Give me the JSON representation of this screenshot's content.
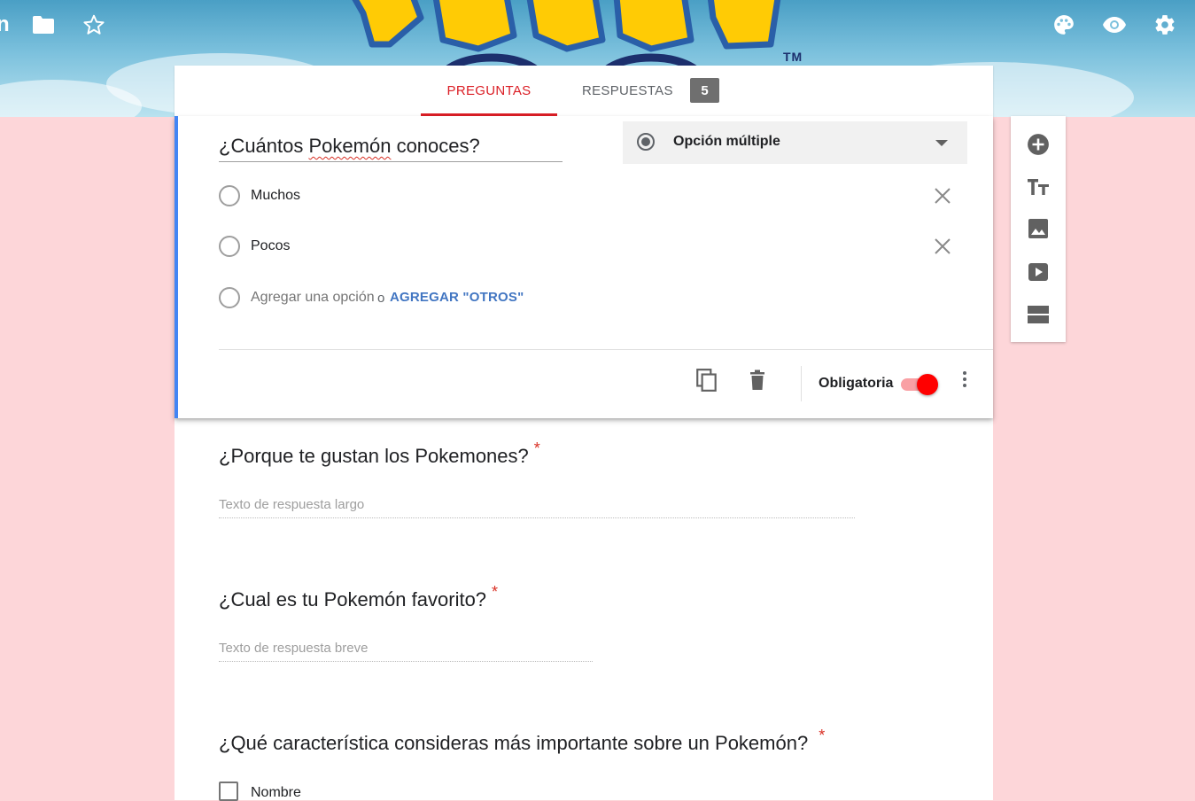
{
  "header": {
    "partial_title": "n",
    "logo_tm": "TM",
    "icons": [
      "folder-icon",
      "star-icon",
      "palette-icon",
      "eye-icon",
      "gear-icon"
    ]
  },
  "tabs": {
    "questions_label": "PREGUNTAS",
    "responses_label": "RESPUESTAS",
    "responses_count": "5"
  },
  "active_question": {
    "title_before": "¿Cuántos ",
    "title_misspelled": "Pokemón",
    "title_after": " conoces?",
    "type_label": "Opción múltiple",
    "options": [
      {
        "label": "Muchos"
      },
      {
        "label": "Pocos"
      }
    ],
    "add_option_label": "Agregar una opción",
    "or_label": "o",
    "add_other_label": "AGREGAR \"OTROS\"",
    "required_label": "Obligatoria",
    "required_on": true
  },
  "questions": [
    {
      "title": "¿Porque te gustan los Pokemones?",
      "required_mark": "*",
      "answer_placeholder": "Texto de respuesta largo"
    },
    {
      "title": "¿Cual es tu Pokemón favorito?",
      "required_mark": "*",
      "answer_placeholder": "Texto de respuesta breve"
    },
    {
      "title": "¿Qué característica consideras más importante sobre un Pokemón?",
      "required_mark": "*",
      "checkbox_options": [
        "Nombre"
      ]
    }
  ],
  "side_toolbar": {
    "icons": [
      "add-question-icon",
      "add-title-icon",
      "add-image-icon",
      "add-video-icon",
      "add-section-icon"
    ]
  },
  "colors": {
    "accent": "#db1f26",
    "background": "#fdd6d9",
    "link_blue": "#4276c2",
    "active_bar": "#4285f4"
  }
}
